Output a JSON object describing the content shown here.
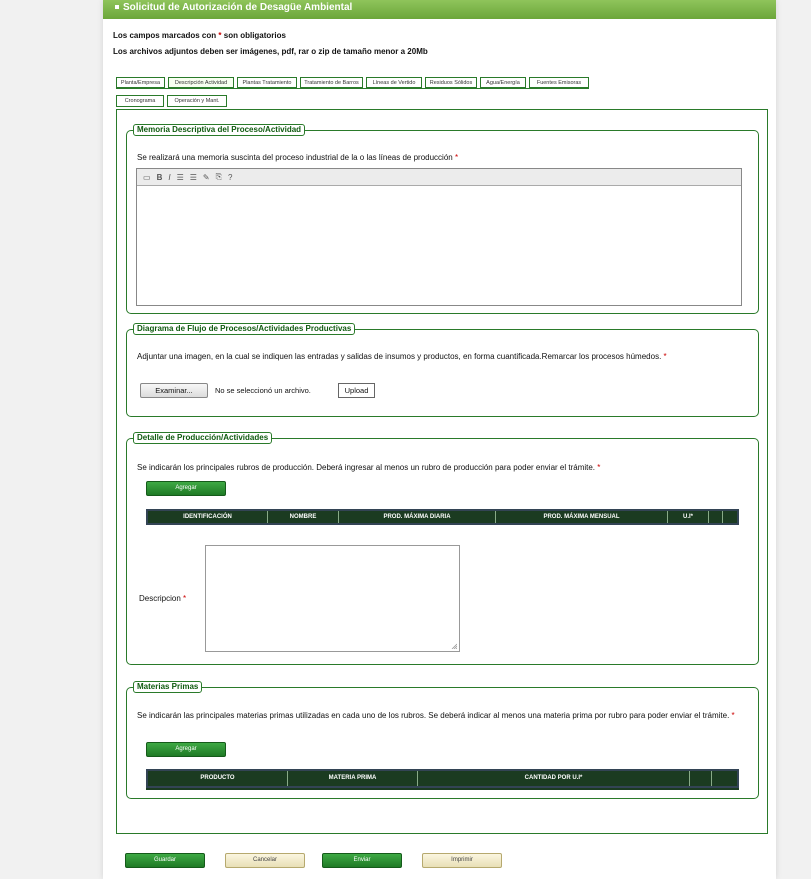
{
  "window": {
    "title": "Solicitud de Autorización de Desagüe Ambiental"
  },
  "notes": {
    "required_prefix": "Los campos marcados con",
    "required_suffix": "son obligatorios",
    "attachments": "Los archivos adjuntos deben ser imágenes, pdf, rar o zip de tamaño menor a 20Mb"
  },
  "tabs": [
    {
      "label": "Planta/Empresa"
    },
    {
      "label": "Descripción Actividad"
    },
    {
      "label": "Plantas Tratamiento"
    },
    {
      "label": "Tratamiento de Barros"
    },
    {
      "label": "Líneas de Vertido"
    },
    {
      "label": "Residuos Sólidos"
    },
    {
      "label": "Agua/Energía"
    },
    {
      "label": "Fuentes Emisoras"
    },
    {
      "label": "Cronograma"
    },
    {
      "label": "Operación y Mant."
    }
  ],
  "active_tab": "Descripción Actividad",
  "memoria": {
    "legend": "Memoria Descriptiva del Proceso/Actividad",
    "instruction": "Se realizará una memoria suscinta del proceso industrial de la o las líneas de producción",
    "toolbar_glyphs": [
      "▭",
      "B",
      "I",
      "☰",
      "☰",
      "✎",
      "⎘",
      "?"
    ]
  },
  "diagrama": {
    "legend": "Diagrama de Flujo de Procesos/Actividades Productivas",
    "instruction": "Adjuntar una imagen, en la cual se indiquen las entradas y salidas de insumos y productos, en forma cuantificada.Remarcar los procesos húmedos.",
    "browse_label": "Examinar...",
    "file_status": "No se seleccionó un archivo.",
    "upload_label": "Upload"
  },
  "produccion": {
    "legend": "Detalle de Producción/Actividades",
    "instruction": "Se indicarán los principales rubros de producción. Deberá ingresar al menos un rubro de producción para poder enviar el trámite.",
    "add_label": "Agregar",
    "columns": [
      "IDENTIFICACIÓN",
      "NOMBRE",
      "PROD. MÁXIMA DIARIA",
      "PROD. MÁXIMA MENSUAL",
      "U.I*",
      "",
      ""
    ],
    "descripcion_label": "Descripcion"
  },
  "materias": {
    "legend": "Materias Primas",
    "instruction": "Se indicarán las principales materias primas utilizadas en cada uno de los rubros. Se deberá indicar al menos una materia prima por rubro para poder enviar el trámite.",
    "add_label": "Agregar",
    "columns": [
      "PRODUCTO",
      "MATERIA PRIMA",
      "CANTIDAD POR U.I*",
      "",
      ""
    ]
  },
  "footer": {
    "save": "Guardar",
    "cancel": "Cancelar",
    "send": "Enviar",
    "print": "Imprimir"
  },
  "colors": {
    "accent_green": "#2a7a2a",
    "button_green": "#1f7a25",
    "header_dark": "#1b3b21",
    "required_red": "#cc0000"
  }
}
